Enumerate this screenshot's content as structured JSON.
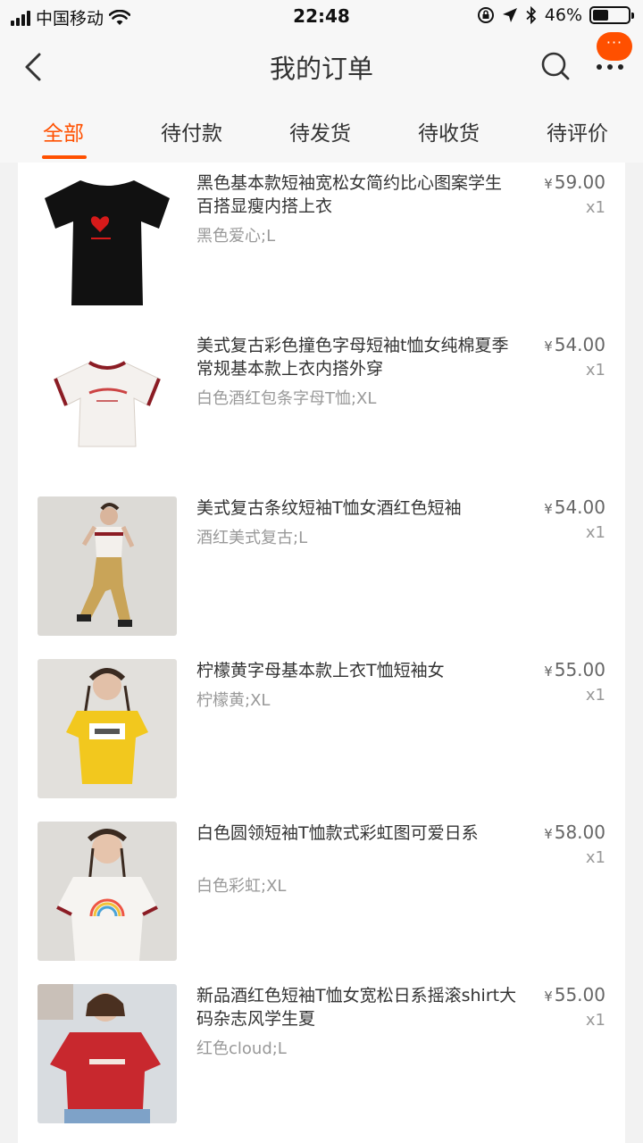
{
  "status_bar": {
    "carrier": "中国移动",
    "time": "22:48",
    "battery_percent": "46%",
    "battery_level": 0.46,
    "icons": [
      "signal-icon",
      "wifi-icon",
      "orientation-lock-icon",
      "location-arrow-icon",
      "bluetooth-icon",
      "battery-icon"
    ]
  },
  "header": {
    "title": "我的订单",
    "badge_text": "···",
    "icons": [
      "back-arrow-icon",
      "search-icon",
      "more-dots-icon"
    ]
  },
  "tabs": [
    {
      "label": "全部",
      "active": true
    },
    {
      "label": "待付款",
      "active": false
    },
    {
      "label": "待发货",
      "active": false
    },
    {
      "label": "待收货",
      "active": false
    },
    {
      "label": "待评价",
      "active": false
    }
  ],
  "accent_color": "#ff5000",
  "currency_symbol": "¥",
  "items": [
    {
      "title": "黑色基本款短袖宽松女简约比心图案学生百搭显瘦内搭上衣",
      "sku": "黑色爱心;L",
      "price": "59.00",
      "qty": "x1",
      "image": "black-tshirt-heart-photo"
    },
    {
      "title": "美式复古彩色撞色字母短袖t恤女纯棉夏季常规基本款上衣内搭外穿",
      "sku": "白色酒红包条字母T恤;XL",
      "price": "54.00",
      "qty": "x1",
      "image": "white-ringer-tshirt-photo"
    },
    {
      "title": "美式复古条纹短袖T恤女酒红色短袖",
      "sku": "酒红美式复古;L",
      "price": "54.00",
      "qty": "x1",
      "image": "model-striped-tshirt-photo"
    },
    {
      "title": "柠檬黄字母基本款上衣T恤短袖女",
      "sku": "柠檬黄;XL",
      "price": "55.00",
      "qty": "x1",
      "image": "model-yellow-nice-tshirt-photo"
    },
    {
      "title": "白色圆领短袖T恤款式彩虹图可爱日系",
      "sku": "白色彩虹;XL",
      "price": "58.00",
      "qty": "x1",
      "image": "model-rainbow-tshirt-photo"
    },
    {
      "title": "新品酒红色短袖T恤女宽松日系摇滚shirt大码杂志风学生夏",
      "sku": "红色cloud;L",
      "price": "55.00",
      "qty": "x1",
      "image": "model-red-clouds-tshirt-photo"
    }
  ]
}
